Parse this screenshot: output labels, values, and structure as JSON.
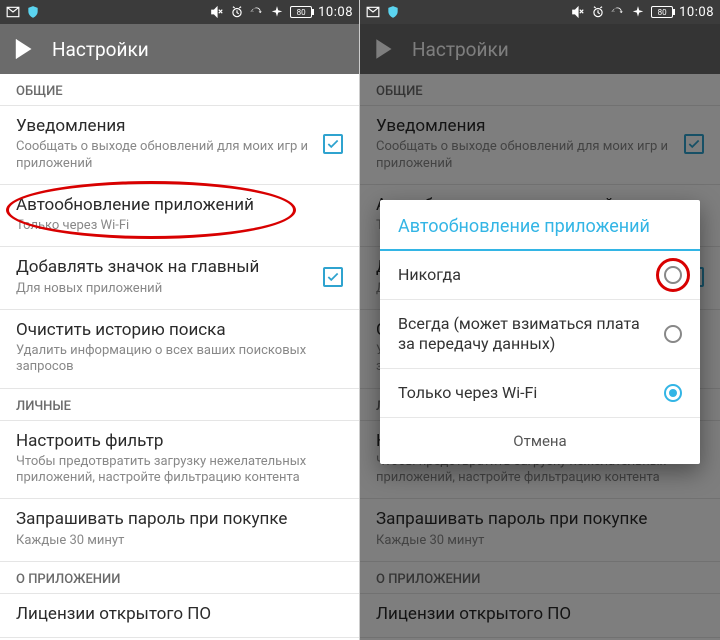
{
  "status": {
    "time": "10:08",
    "battery": "80"
  },
  "actionbar": {
    "title": "Настройки"
  },
  "sections": {
    "general": "ОБЩИЕ",
    "personal": "ЛИЧНЫЕ",
    "about": "О ПРИЛОЖЕНИИ"
  },
  "rows": {
    "notifications": {
      "title": "Уведомления",
      "sub": "Сообщать о выходе обновлений для моих игр и приложений"
    },
    "autoupdate": {
      "title": "Автообновление приложений",
      "sub": "Только через Wi-Fi"
    },
    "addicon": {
      "title": "Добавлять значок на главный",
      "sub": "Для новых приложений"
    },
    "clearsearch": {
      "title": "Очистить историю поиска",
      "sub": "Удалить информацию о всех ваших поисковых запросов"
    },
    "filter": {
      "title": "Настроить фильтр",
      "sub": "Чтобы предотвратить загрузку нежелательных приложений, настройте фильтрацию контента"
    },
    "password": {
      "title": "Запрашивать пароль при покупке",
      "sub": "Каждые 30 минут"
    },
    "license": {
      "title": "Лицензии открытого ПО"
    }
  },
  "dialog": {
    "title": "Автообновление приложений",
    "options": {
      "never": "Никогда",
      "always": "Всегда (может взиматься плата за передачу данных)",
      "wifi": "Только через Wi-Fi"
    },
    "cancel": "Отмена"
  }
}
